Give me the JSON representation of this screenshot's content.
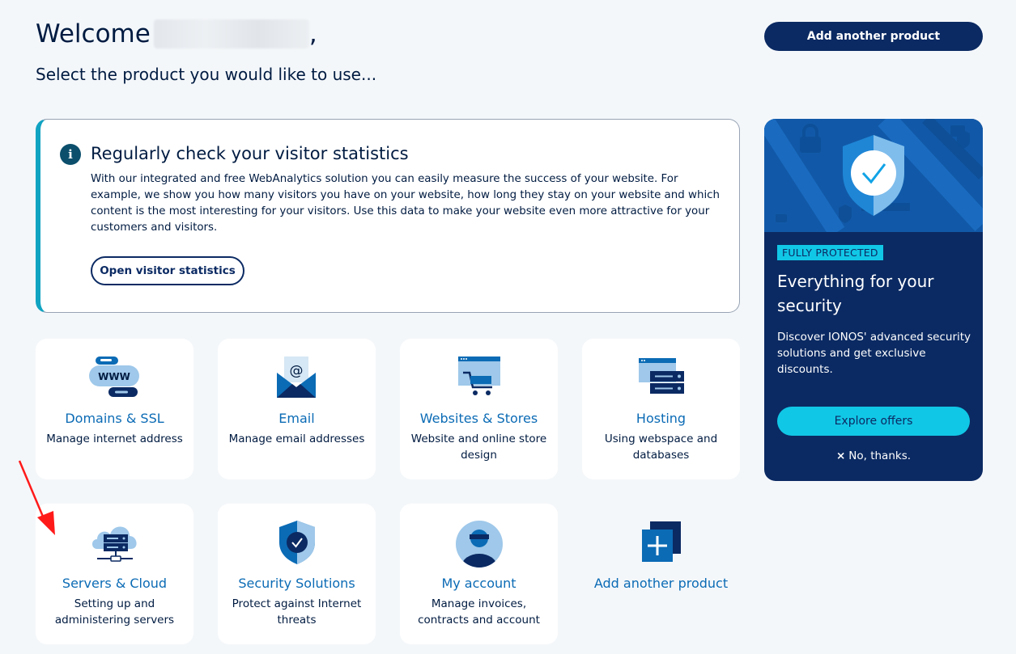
{
  "header": {
    "welcome": "Welcome",
    "comma": ",",
    "subtitle": "Select the product you would like to use...",
    "add_product_button": "Add another product"
  },
  "info_card": {
    "title": "Regularly check your visitor statistics",
    "text": "With our integrated and free WebAnalytics solution you can easily measure the success of your website. For example, we show you how many visitors you have on your website, how long they stay on your website and which content is the most interesting for your visitors. Use this data to make your website even more attractive for your customers and visitors.",
    "button": "Open visitor statistics"
  },
  "tiles": [
    {
      "title": "Domains & SSL",
      "desc": "Manage internet address",
      "icon": "www-icon",
      "icon_text": "WWW"
    },
    {
      "title": "Email",
      "desc": "Manage email addresses",
      "icon": "email-icon",
      "icon_text": "@"
    },
    {
      "title": "Websites & Stores",
      "desc": "Website and online store design",
      "icon": "shopping-cart-icon"
    },
    {
      "title": "Hosting",
      "desc": "Using webspace and databases",
      "icon": "server-icon"
    },
    {
      "title": "Servers & Cloud",
      "desc": "Setting up and administering servers",
      "icon": "cloud-server-icon"
    },
    {
      "title": "Security Solutions",
      "desc": "Protect against Internet threats",
      "icon": "shield-icon"
    },
    {
      "title": "My account",
      "desc": "Manage invoices, contracts and account",
      "icon": "user-icon"
    },
    {
      "title": "Add another product",
      "desc": "",
      "icon": "plus-icon"
    }
  ],
  "promo": {
    "badge": "FULLY PROTECTED",
    "title": "Everything for your security",
    "text": "Discover IONOS' advanced security solutions and get exclusive discounts.",
    "button": "Explore offers",
    "dismiss_icon": "×",
    "dismiss": "No, thanks."
  },
  "colors": {
    "navy": "#0b2a63",
    "accent_cyan": "#11c7e6",
    "link_blue": "#0b6bb5",
    "background": "#f4f7fa"
  }
}
